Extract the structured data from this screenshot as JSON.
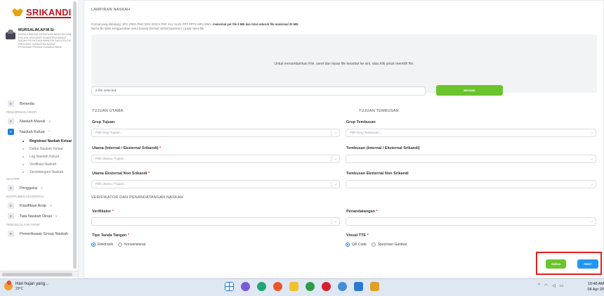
{
  "sidebar": {
    "logo": "SRIKANDI",
    "user_name": "MURSALIM,AP.M.Si",
    "user_title": "KEPALA BADAN KESATUAN BANGSA DAN POLITIK PROVINSI SUMATERA BARAT - BADAN KESATUAN BANGSA DAN POLITIK PROVINSI SUMATERA BARAT",
    "user_org": "Pemerintah Provinsi Sumatera Barat",
    "items": [
      {
        "type": "item",
        "label": "Beranda",
        "icon": "home-icon"
      },
      {
        "type": "section",
        "label": "PENGIRIMAN ARSIP"
      },
      {
        "type": "item",
        "label": "Naskah Masuk",
        "icon": "inbox-icon",
        "chevron": "v"
      },
      {
        "type": "item",
        "label": "Naskah Keluar",
        "icon": "outbox-icon",
        "chevron": "^",
        "active": true
      },
      {
        "type": "sub",
        "label": "Registrasi Naskah Keluar",
        "current": true
      },
      {
        "type": "sub",
        "label": "Daftar Naskah Keluar"
      },
      {
        "type": "sub",
        "label": "Log Naskah Keluar"
      },
      {
        "type": "sub",
        "label": "Verifikasi Naskah"
      },
      {
        "type": "sub",
        "label": "Tandatangani Naskah"
      },
      {
        "type": "section",
        "label": "MASTER"
      },
      {
        "type": "item",
        "label": "Pengguna",
        "icon": "users-icon",
        "chevron": "v"
      },
      {
        "type": "section",
        "label": "INSTRUMEN KEARSIPAN"
      },
      {
        "type": "item",
        "label": "Klasifikasi Arsip",
        "icon": "folder-icon",
        "chevron": "v"
      },
      {
        "type": "item",
        "label": "Tata Naskah Dinas",
        "icon": "document-icon",
        "chevron": "v"
      },
      {
        "type": "section",
        "label": "PENGELOLAAN ARSIP"
      },
      {
        "type": "item",
        "label": "Pemeriksaan Group Naskah",
        "icon": "archive-icon"
      }
    ]
  },
  "attachment": {
    "title": "LAMPIRAN NASKAH",
    "note_line1_prefix": "Format yang didukung: JPG JPEG PNG DOC DOCX PDF XLS XLSX PPT PPTX MP4 WMV, ",
    "note_line1_bold": "maksimal per file 5 MB dan total seluruh file maksimal 20 MB.",
    "note_line2": "Nama file tidak menggunakan unsur [tanda] (format) simbol [spesial] ( ) pada nama file",
    "dropzone_text": "Untuk menambahkan File, seret dan lepas file tersebut ke sini, atau klik untuk memilih file.",
    "file_selected": "6 file selected",
    "browse_label": "BROWSE"
  },
  "tujuan_utama": {
    "title": "TUJUAN UTAMA",
    "grup_label": "Grup Tujuan",
    "grup_placeholder": "Pilih Grup Tujuan...",
    "utama_label": "Utama (Internal / Eksternal Srikandi)",
    "utama_placeholder": "Pilih Utama / Tujuan...",
    "eksternal_label": "Utama Eksternal Non Srikandi",
    "eksternal_placeholder": "Pilih Utama / Tujuan..."
  },
  "tujuan_tembusan": {
    "title": "TUJUAN TEMBUSAN",
    "grup_label": "Grup Tembusan",
    "grup_placeholder": "Pilih Grup Tembusan...",
    "tembusan_label": "Tembusan (Internal / Eksternal Srikandi)",
    "eksternal_label": "Tembusan Eksternal Non Srikandi"
  },
  "verifikator": {
    "title": "VERIFIKATOR DAN PENANDATANGAN NASKAH",
    "verifikator_label": "Verifikator",
    "penandatangan_label": "Penandatangan",
    "tipe_label": "Tipe Tanda Tangan",
    "tipe_options": [
      "Elektronik",
      "Konvensional"
    ],
    "visual_label": "Visual TTE",
    "visual_options": [
      "QR Code",
      "Specimen Gambar"
    ]
  },
  "actions": {
    "simpan": "SIMPAN",
    "reset": "RESET"
  },
  "taskbar": {
    "weather_text": "Hari hujan yang...",
    "weather_temp": "29°C",
    "notif_count": "1",
    "time": "10:48 AM",
    "date": "04 Apr 20"
  }
}
